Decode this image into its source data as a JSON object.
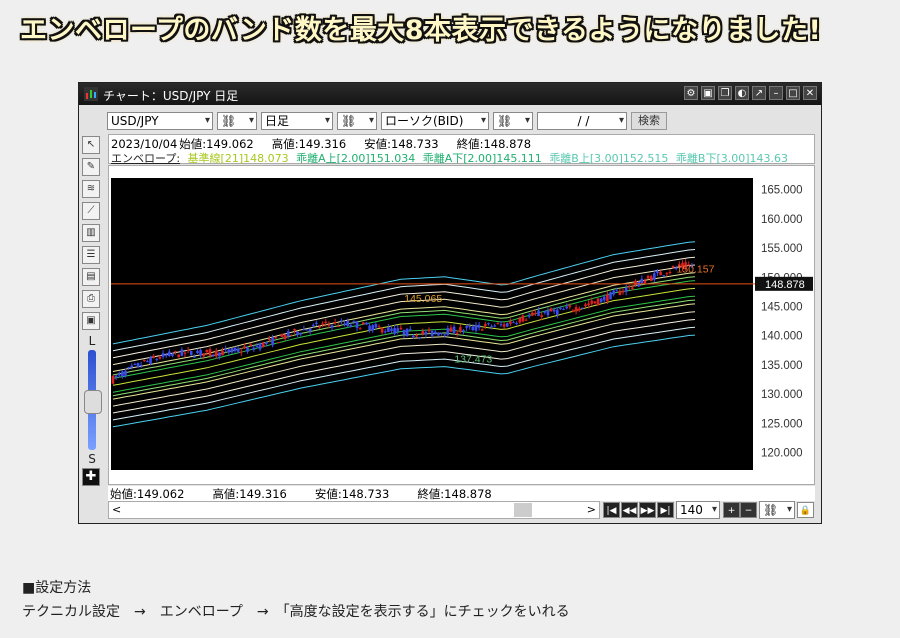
{
  "headline": "エンベロープのバンド数を最大8本表示できるようになりました!",
  "window": {
    "title": "チャート：USD/JPY 日足",
    "title_buttons": [
      "settings-icon",
      "pin-icon",
      "copy-icon",
      "palette-icon",
      "arrow-icon",
      "minimize-icon",
      "maximize-icon",
      "close-icon"
    ]
  },
  "toolbar": {
    "symbol": "USD/JPY",
    "timeframe": "日足",
    "price_type": "ローソク(BID)",
    "date": "/ /",
    "search": "検索"
  },
  "info": {
    "date": "2023/10/04",
    "open": "始値:149.062",
    "high": "高値:149.316",
    "low": "安値:148.733",
    "close": "終値:148.878"
  },
  "envelope": {
    "label": "エンベロープ:",
    "base": "基準線[21]148.073",
    "a_up": "乖離A上[2.00]151.034",
    "a_down": "乖離A下[2.00]145.111",
    "b_up": "乖離B上[3.00]152.515",
    "b_down": "乖離B下[3.00]143.63"
  },
  "bottom": {
    "open": "始値:149.062",
    "high": "高値:149.316",
    "low": "安値:148.733",
    "close": "終値:148.878",
    "bars": "140"
  },
  "side": {
    "label_top": "L",
    "label_bottom": "S"
  },
  "notes": {
    "heading": "■設定方法",
    "body": "テクニカル設定　→　エンベロープ　→　「高度な設定を表示する」にチェックをいれる"
  },
  "chart_data": {
    "type": "line",
    "y_ticks": [
      "165.000",
      "160.000",
      "155.000",
      "150.000",
      "145.000",
      "140.000",
      "135.000",
      "130.000",
      "125.000",
      "120.000"
    ],
    "ylim": [
      117,
      167
    ],
    "current_price": "148.878",
    "annotations": [
      {
        "text": "145.065",
        "x": 95,
        "y": 145.07
      },
      {
        "text": "137.473",
        "x": 111,
        "y": 137.47
      },
      {
        "text": "150.157",
        "x": 182,
        "y": 150.16
      }
    ],
    "base_line": [
      [
        0,
        131.5
      ],
      [
        30,
        134.5
      ],
      [
        60,
        138.5
      ],
      [
        92,
        142.0
      ],
      [
        106,
        142.4
      ],
      [
        125,
        141.0
      ],
      [
        135,
        142.5
      ],
      [
        160,
        146.0
      ],
      [
        185,
        148.1
      ]
    ],
    "envelope_offsets_pct": [
      -12,
      -10,
      -8,
      -6,
      -4,
      -3,
      -2,
      0,
      2,
      3,
      4,
      6,
      8,
      10,
      12
    ],
    "colors": {
      "background": "#000000",
      "price_line": "#e8521a",
      "up": "#e02020",
      "down": "#3a4cf0",
      "base": "#c9e43a"
    }
  }
}
